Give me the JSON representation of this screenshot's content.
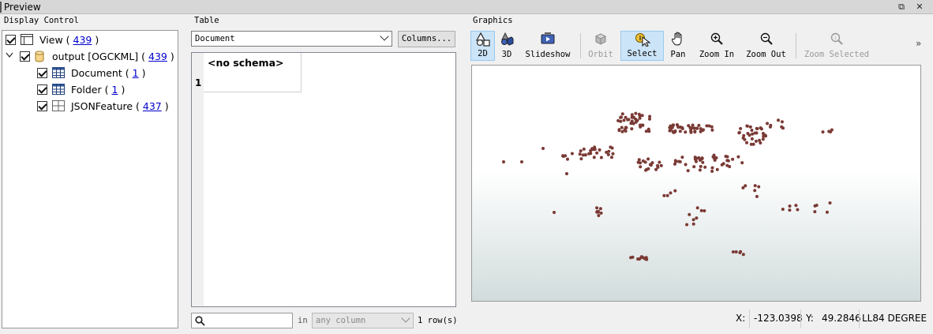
{
  "window": {
    "title": "Preview",
    "restore_glyph": "⧉",
    "close_glyph": "✕"
  },
  "display_control": {
    "label": "Display Control",
    "tree": [
      {
        "name": "View",
        "count": "439",
        "icon": "view-icon",
        "level": 0,
        "checked": true
      },
      {
        "name": "output [OGCKML]",
        "count": "439",
        "icon": "database-icon",
        "level": 0,
        "checked": true,
        "expanded": true
      },
      {
        "name": "Document",
        "count": "1",
        "icon": "table-grid-icon",
        "level": 1,
        "checked": true
      },
      {
        "name": "Folder",
        "count": "1",
        "icon": "table-grid-icon",
        "level": 1,
        "checked": true
      },
      {
        "name": "JSONFeature",
        "count": "437",
        "icon": "feature-grid-icon",
        "level": 1,
        "checked": true
      }
    ],
    "paren_open": "(",
    "paren_close": ")"
  },
  "table": {
    "label": "Table",
    "selected_dataset": "Document",
    "columns_button": "Columns...",
    "no_schema": "<no schema>",
    "row_number": "1",
    "search_placeholder": "",
    "in_label": "in",
    "column_filter": "any column",
    "row_count": "1 row(s)"
  },
  "graphics": {
    "label": "Graphics",
    "tools": [
      {
        "id": "2d",
        "label": "2D",
        "icon": "2d-icon",
        "active": true,
        "disabled": false
      },
      {
        "id": "3d",
        "label": "3D",
        "icon": "3d-icon",
        "active": false,
        "disabled": false
      },
      {
        "id": "slideshow",
        "label": "Slideshow",
        "icon": "slideshow-icon",
        "active": false,
        "disabled": false
      },
      {
        "id": "orbit",
        "label": "Orbit",
        "icon": "orbit-icon",
        "active": false,
        "disabled": true
      },
      {
        "id": "select",
        "label": "Select",
        "icon": "select-icon",
        "active": true,
        "disabled": false
      },
      {
        "id": "pan",
        "label": "Pan",
        "icon": "pan-hand-icon",
        "active": false,
        "disabled": false
      },
      {
        "id": "zoom_in",
        "label": "Zoom In",
        "icon": "zoom-in-icon",
        "active": false,
        "disabled": false
      },
      {
        "id": "zoom_out",
        "label": "Zoom Out",
        "icon": "zoom-out-icon",
        "active": false,
        "disabled": false
      },
      {
        "id": "zoom_selected",
        "label": "Zoom Selected",
        "icon": "zoom-selected-icon",
        "active": false,
        "disabled": true
      }
    ],
    "overflow_glyph": "»",
    "point_color": "#7a3a35",
    "status": {
      "x_label": "X:",
      "x_value": "-123.0398",
      "y_label": "Y:",
      "y_value": "49.2846",
      "crs": "LL84",
      "units": "DEGREE"
    }
  }
}
